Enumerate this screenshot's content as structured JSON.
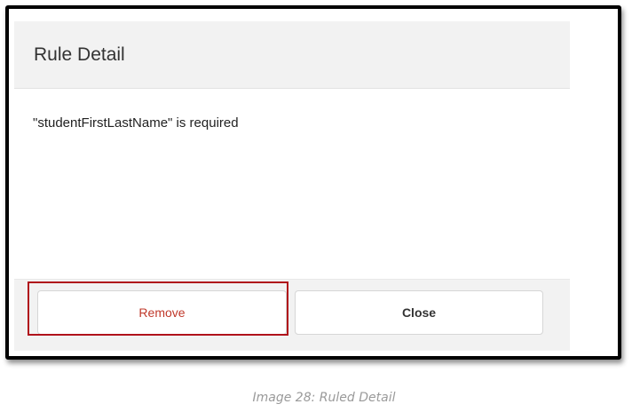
{
  "dialog": {
    "title": "Rule Detail",
    "message": "\"studentFirstLastName\" is required",
    "remove_label": "Remove",
    "close_label": "Close"
  },
  "caption": "Image 28: Ruled Detail",
  "colors": {
    "remove_text": "#c0392b",
    "highlight_border": "#b0121b",
    "header_bg": "#f2f2f2"
  }
}
